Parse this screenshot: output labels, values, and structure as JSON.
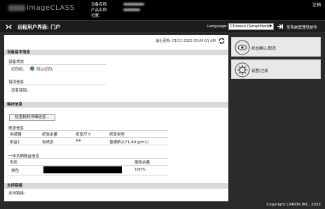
{
  "header": {
    "brand": "imageCLASS",
    "device_labels": [
      "设备名称:",
      "产品名称:",
      "位置:"
    ],
    "logout": "注销"
  },
  "portal": {
    "title": "远程用户界面: 门户",
    "language_label": "Language:",
    "language_value": "Chinese (Simplified)",
    "to_admin": "至系统管理员邮件"
  },
  "main": {
    "last_updated": "最近更新: 01/11 2022 03:04:01 AM",
    "device_basic_info": "设备基本信息",
    "device_status_label": "设备状态",
    "printer_label": "打印机:",
    "printer_status": "可以打印。",
    "error_info_label": "错误信息",
    "error_info_value": "没有错误。",
    "consumables_info": "耗材信息",
    "check_details_button": "检查耗材详细信息...",
    "paper_info_label": "纸张信息",
    "paper_table": {
      "headers": [
        "供纸器",
        "纸张余量",
        "纸张尺寸",
        "纸张类型"
      ],
      "rows": [
        [
          "纸盒1",
          "有纸张",
          "A4",
          "普通纸2(71-89 g/m2)"
        ]
      ]
    },
    "cartridge_label": "一体式硒鼓盒信息",
    "cartridge_table": {
      "headers": [
        "色彩",
        "墨粉余量"
      ],
      "rows": [
        [
          "黑色",
          "100%"
        ]
      ]
    },
    "toner_level": 1.0,
    "support_label": "支持链接",
    "support_link": "支持链接:"
  },
  "right_panel": {
    "status_button": "状态确认/取消",
    "settings_button": "设置/注册"
  },
  "footer": {
    "copyright": "Copyright CANON INC. 2022"
  },
  "colors": {
    "header_bg": "#000000",
    "panel_bg": "#ffffff",
    "section_bg": "#d9d9d9",
    "status_ok": "#2fa84f"
  }
}
